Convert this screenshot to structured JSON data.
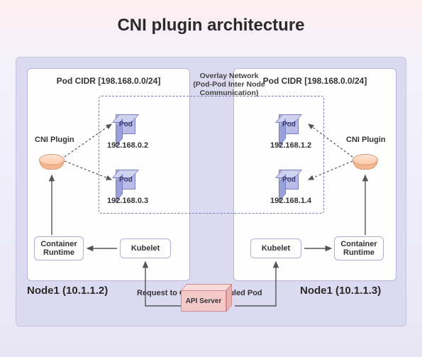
{
  "title": "CNI plugin architecture",
  "overlay_label": "Overlay Network (Pod-Pod Inter Node Communication)",
  "nodes": {
    "left": {
      "pod_cidr": "Pod CIDR [198.168.0.0/24]",
      "cni_label": "CNI Plugin",
      "pods": [
        {
          "label": "Pod",
          "ip": "192.168.0.2"
        },
        {
          "label": "Pod",
          "ip": "192.168.0.3"
        }
      ],
      "container_runtime": "Container Runtime",
      "kubelet": "Kubelet",
      "name": "Node1 (10.1.1.2)"
    },
    "right": {
      "pod_cidr": "Pod CIDR [198.168.0.0/24]",
      "cni_label": "CNI Plugin",
      "pods": [
        {
          "label": "Pod",
          "ip": "192.168.1.2"
        },
        {
          "label": "Pod",
          "ip": "192.168.1.4"
        }
      ],
      "container_runtime": "Container Runtime",
      "kubelet": "Kubelet",
      "name": "Node1 (10.1.1.3)"
    }
  },
  "api_server": "API Server",
  "request_label": "Request to Create Scheduled Pod"
}
